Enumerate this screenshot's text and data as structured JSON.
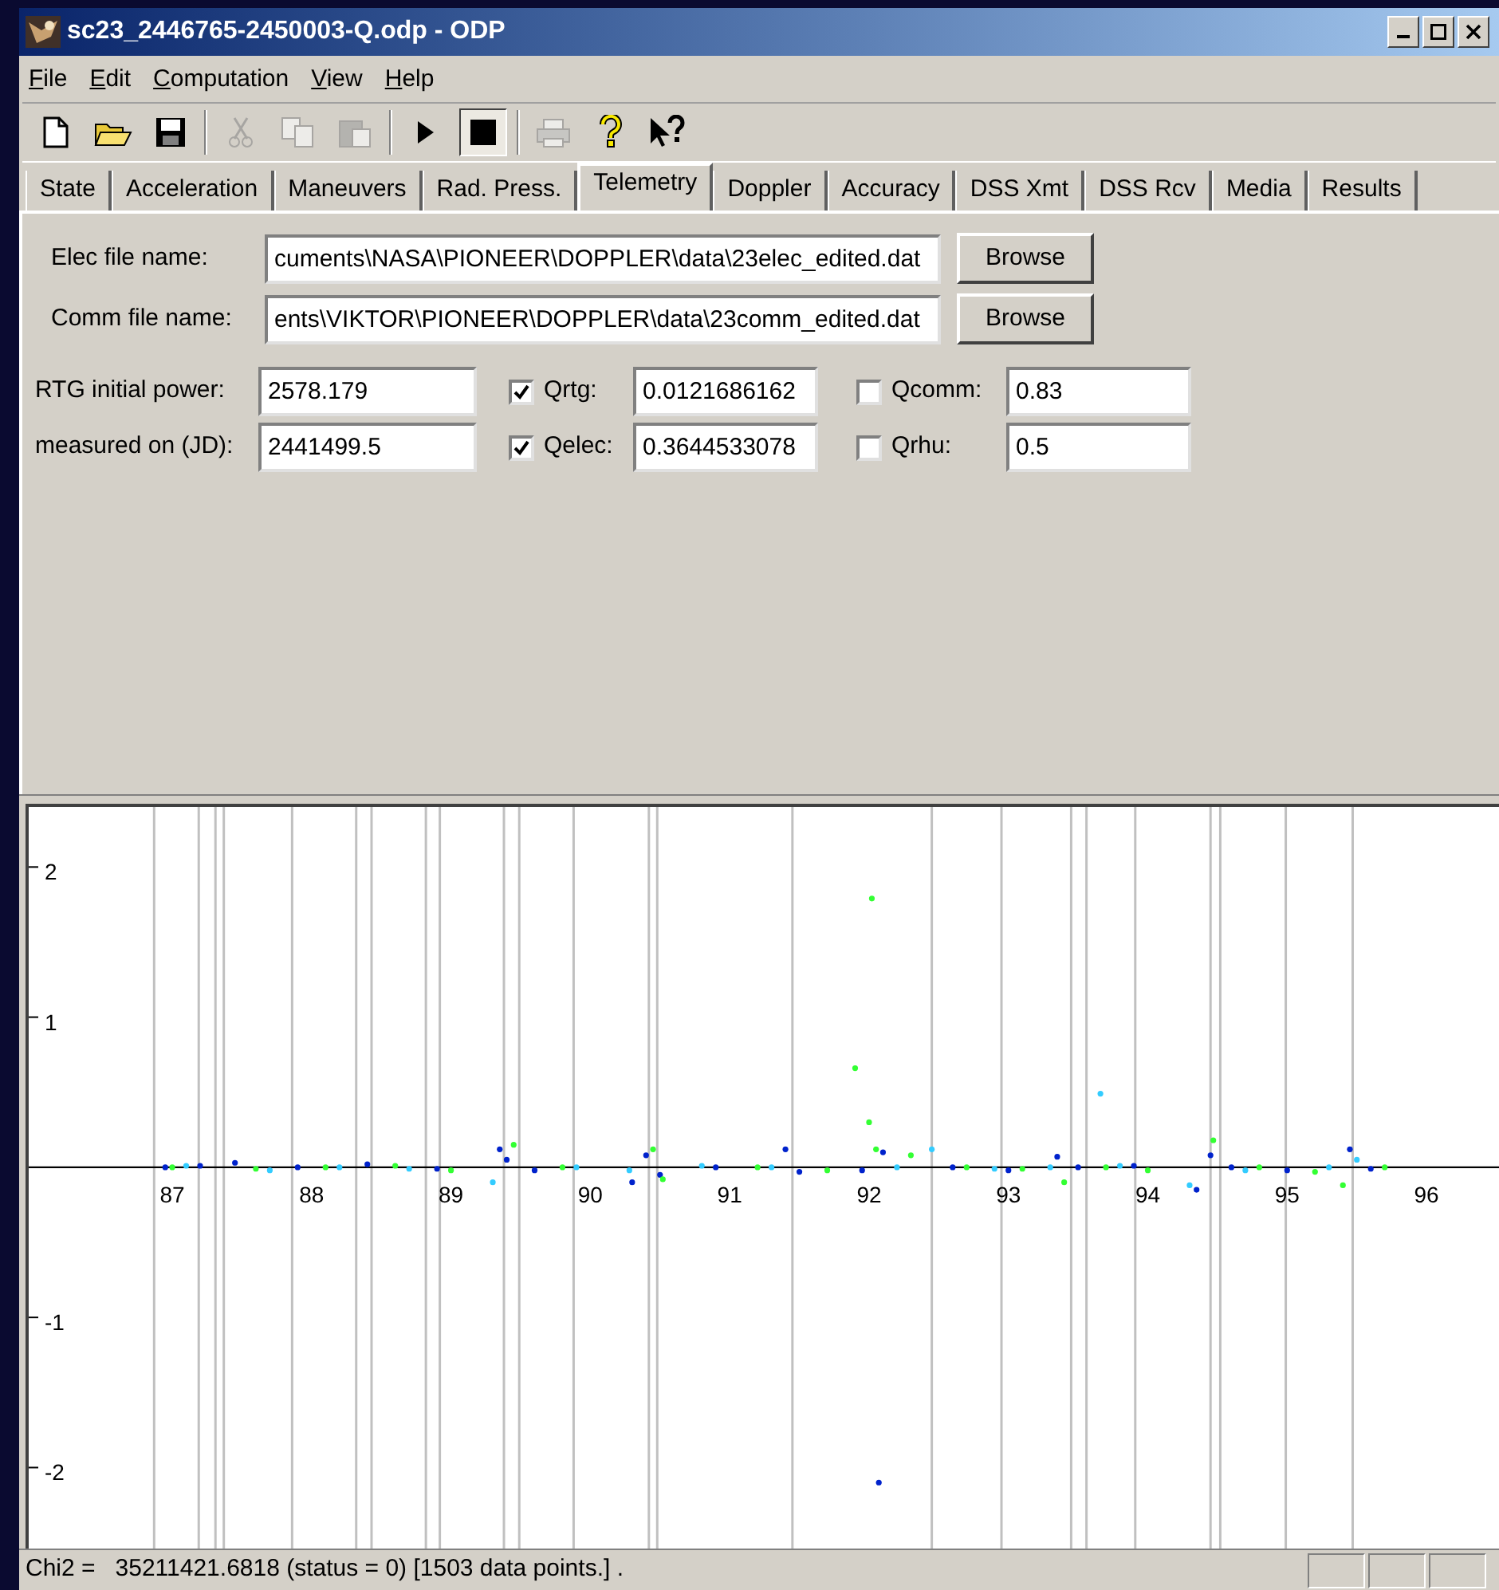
{
  "window": {
    "title": "sc23_2446765-2450003-Q.odp - ODP"
  },
  "menu": [
    {
      "label": "File"
    },
    {
      "label": "Edit"
    },
    {
      "label": "Computation"
    },
    {
      "label": "View"
    },
    {
      "label": "Help"
    }
  ],
  "toolbar": [
    {
      "kind": "new",
      "disabled": false,
      "pressed": false
    },
    {
      "kind": "open",
      "disabled": false,
      "pressed": false
    },
    {
      "kind": "save",
      "disabled": false,
      "pressed": false
    },
    {
      "kind": "sep"
    },
    {
      "kind": "cut",
      "disabled": true,
      "pressed": false
    },
    {
      "kind": "copy",
      "disabled": true,
      "pressed": false
    },
    {
      "kind": "paste",
      "disabled": true,
      "pressed": false
    },
    {
      "kind": "sep"
    },
    {
      "kind": "run",
      "disabled": false,
      "pressed": false
    },
    {
      "kind": "stop",
      "disabled": false,
      "pressed": true
    },
    {
      "kind": "sep"
    },
    {
      "kind": "print",
      "disabled": true,
      "pressed": false
    },
    {
      "kind": "help",
      "disabled": false,
      "pressed": false
    },
    {
      "kind": "context-help",
      "disabled": false,
      "pressed": false
    }
  ],
  "tabs": [
    {
      "label": "State",
      "selected": false
    },
    {
      "label": "Acceleration",
      "selected": false
    },
    {
      "label": "Maneuvers",
      "selected": false
    },
    {
      "label": "Rad. Press.",
      "selected": false
    },
    {
      "label": "Telemetry",
      "selected": true
    },
    {
      "label": "Doppler",
      "selected": false
    },
    {
      "label": "Accuracy",
      "selected": false
    },
    {
      "label": "DSS Xmt",
      "selected": false
    },
    {
      "label": "DSS Rcv",
      "selected": false
    },
    {
      "label": "Media",
      "selected": false
    },
    {
      "label": "Results",
      "selected": false
    }
  ],
  "files": [
    {
      "label": "Elec file name:",
      "value": "cuments\\NASA\\PIONEER\\DOPPLER\\data\\23elec_edited.dat",
      "button": "Browse"
    },
    {
      "label": "Comm file name:",
      "value": "ents\\VIKTOR\\PIONEER\\DOPPLER\\data\\23comm_edited.dat",
      "button": "Browse"
    }
  ],
  "params": [
    {
      "label": "RTG initial power:",
      "value": "2578.179",
      "q1": {
        "label": "Qrtg:",
        "checked": true,
        "value": "0.0121686162"
      },
      "q2": {
        "label": "Qcomm:",
        "checked": false,
        "value": "0.83"
      }
    },
    {
      "label": "measured on (JD):",
      "value": "2441499.5",
      "q1": {
        "label": "Qelec:",
        "checked": true,
        "value": "0.3644533078"
      },
      "q2": {
        "label": "Qrhu:",
        "checked": false,
        "value": "0.5"
      }
    }
  ],
  "plot": {
    "chart_data": {
      "type": "scatter",
      "xlim": [
        85.97,
        96.52
      ],
      "ylim": [
        -2.55,
        2.4
      ],
      "xticks": [
        87,
        88,
        89,
        90,
        91,
        92,
        93,
        94,
        95,
        96
      ],
      "yticks": [
        -2,
        -1,
        1,
        2
      ],
      "ref_lines": [
        {
          "axis": "x",
          "value": 86.87
        },
        {
          "axis": "x",
          "value": 87.19
        },
        {
          "axis": "x",
          "value": 87.31
        },
        {
          "axis": "x",
          "value": 87.37
        },
        {
          "axis": "x",
          "value": 87.86
        },
        {
          "axis": "x",
          "value": 88.32
        },
        {
          "axis": "x",
          "value": 88.43
        },
        {
          "axis": "x",
          "value": 88.82
        },
        {
          "axis": "x",
          "value": 88.92
        },
        {
          "axis": "x",
          "value": 89.38
        },
        {
          "axis": "x",
          "value": 89.49
        },
        {
          "axis": "x",
          "value": 89.88
        },
        {
          "axis": "x",
          "value": 90.42
        },
        {
          "axis": "x",
          "value": 90.48
        },
        {
          "axis": "x",
          "value": 91.45
        },
        {
          "axis": "x",
          "value": 92.45
        },
        {
          "axis": "x",
          "value": 92.95
        },
        {
          "axis": "x",
          "value": 93.45
        },
        {
          "axis": "x",
          "value": 93.56
        },
        {
          "axis": "x",
          "value": 93.91
        },
        {
          "axis": "x",
          "value": 94.45
        },
        {
          "axis": "x",
          "value": 94.52
        },
        {
          "axis": "x",
          "value": 94.99
        },
        {
          "axis": "x",
          "value": 95.47
        }
      ],
      "x": [
        86.95,
        87.0,
        87.1,
        87.2,
        87.45,
        87.6,
        87.7,
        87.9,
        88.1,
        88.2,
        88.4,
        88.6,
        88.7,
        88.9,
        89.0,
        89.3,
        89.35,
        89.4,
        89.45,
        89.6,
        89.8,
        89.9,
        90.28,
        90.3,
        90.4,
        90.45,
        90.5,
        90.52,
        90.8,
        90.9,
        91.2,
        91.3,
        91.4,
        91.5,
        91.7,
        91.9,
        91.95,
        92.0,
        92.02,
        92.05,
        92.07,
        92.1,
        92.2,
        92.3,
        92.45,
        92.6,
        92.7,
        92.9,
        93.0,
        93.1,
        93.3,
        93.35,
        93.4,
        93.5,
        93.66,
        93.7,
        93.8,
        93.9,
        94.0,
        94.3,
        94.35,
        94.45,
        94.47,
        94.6,
        94.7,
        94.8,
        95.0,
        95.2,
        95.3,
        95.4,
        95.45,
        95.5,
        95.6,
        95.7
      ],
      "series": [
        {
          "color": "#0022cc",
          "values": [
            0,
            null,
            null,
            0.01,
            0.03,
            null,
            null,
            0,
            null,
            null,
            0.02,
            null,
            null,
            -0.01,
            null,
            null,
            0.12,
            0.05,
            null,
            -0.02,
            null,
            null,
            null,
            -0.1,
            0.08,
            null,
            -0.05,
            null,
            null,
            0,
            null,
            null,
            0.12,
            -0.03,
            null,
            null,
            -0.02,
            null,
            null,
            null,
            -2.1,
            0.1,
            null,
            null,
            null,
            0,
            null,
            null,
            -0.02,
            null,
            null,
            0.07,
            null,
            0,
            null,
            null,
            null,
            0.01,
            null,
            null,
            -0.15,
            0.08,
            null,
            0,
            null,
            null,
            -0.02,
            null,
            null,
            null,
            0.12,
            null,
            -0.01,
            null
          ]
        },
        {
          "color": "#33ff33",
          "values": [
            null,
            0,
            null,
            null,
            null,
            -0.01,
            null,
            null,
            0,
            null,
            null,
            0.01,
            null,
            null,
            -0.02,
            null,
            null,
            null,
            0.15,
            null,
            0,
            null,
            null,
            null,
            null,
            0.12,
            null,
            -0.08,
            null,
            null,
            0,
            null,
            null,
            null,
            -0.02,
            0.66,
            null,
            0.3,
            1.79,
            0.12,
            null,
            null,
            null,
            0.08,
            null,
            null,
            0,
            null,
            null,
            -0.01,
            null,
            null,
            -0.1,
            null,
            null,
            0,
            null,
            null,
            -0.02,
            null,
            null,
            null,
            0.18,
            null,
            null,
            0,
            null,
            -0.03,
            null,
            -0.12,
            null,
            null,
            null,
            0
          ]
        },
        {
          "color": "#33ccff",
          "values": [
            null,
            null,
            0.01,
            null,
            null,
            null,
            -0.02,
            null,
            null,
            0,
            null,
            null,
            -0.01,
            null,
            null,
            -0.1,
            null,
            null,
            null,
            null,
            null,
            0,
            -0.02,
            null,
            null,
            null,
            null,
            null,
            0.01,
            null,
            null,
            0,
            null,
            null,
            null,
            null,
            null,
            null,
            null,
            null,
            null,
            null,
            0,
            null,
            0.12,
            null,
            null,
            -0.01,
            null,
            null,
            0,
            null,
            null,
            null,
            0.49,
            null,
            0.01,
            null,
            null,
            -0.12,
            null,
            null,
            null,
            null,
            -0.02,
            null,
            null,
            null,
            0,
            null,
            null,
            0.05,
            null,
            null
          ]
        }
      ]
    }
  },
  "status_bar": {
    "text": "Chi2 =   35211421.6818 (status = 0) [1503 data points.] ."
  }
}
